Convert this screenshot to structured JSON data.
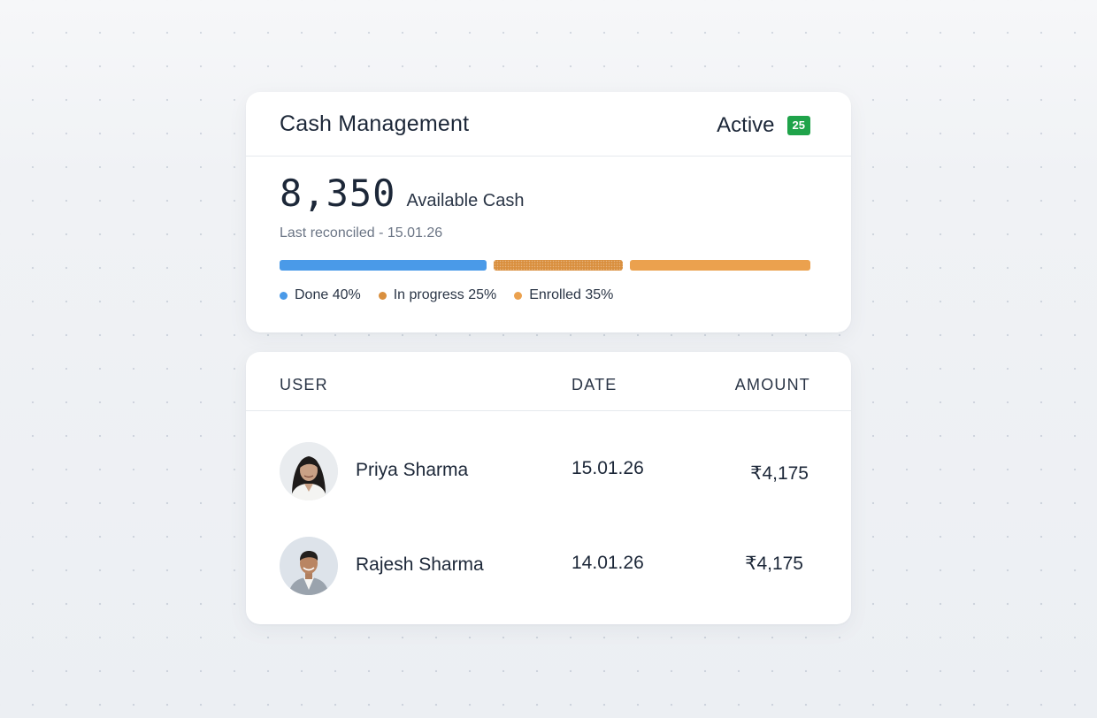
{
  "cash_card": {
    "title": "Cash Management",
    "status": "Active",
    "badge": "25",
    "amount": "8,350",
    "amount_label": "Available Cash",
    "reconciled": "Last reconciled -  15.01.26",
    "progress": [
      {
        "key": "done",
        "label": "Done 40%",
        "percent": 40,
        "color": "#4a9ae8"
      },
      {
        "key": "progress",
        "label": "In progress 25%",
        "percent": 25,
        "color": "#d98f3e"
      },
      {
        "key": "enrolled",
        "label": "Enrolled 35%",
        "percent": 35,
        "color": "#eba14e"
      }
    ]
  },
  "table": {
    "headers": {
      "user": "USER",
      "date": "DATE",
      "amount": "AMOUNT"
    },
    "rows": [
      {
        "name": "Priya Sharma",
        "date": "15.01.26",
        "amount": "₹4,175",
        "avatar": "woman-avatar-icon"
      },
      {
        "name": "Rajesh Sharma",
        "date": "14.01.26",
        "amount": "₹4,175",
        "avatar": "man-avatar-icon"
      }
    ]
  },
  "colors": {
    "badge": "#1fa34a",
    "done": "#4a9ae8",
    "in_progress": "#d98f3e",
    "enrolled": "#eba14e"
  }
}
